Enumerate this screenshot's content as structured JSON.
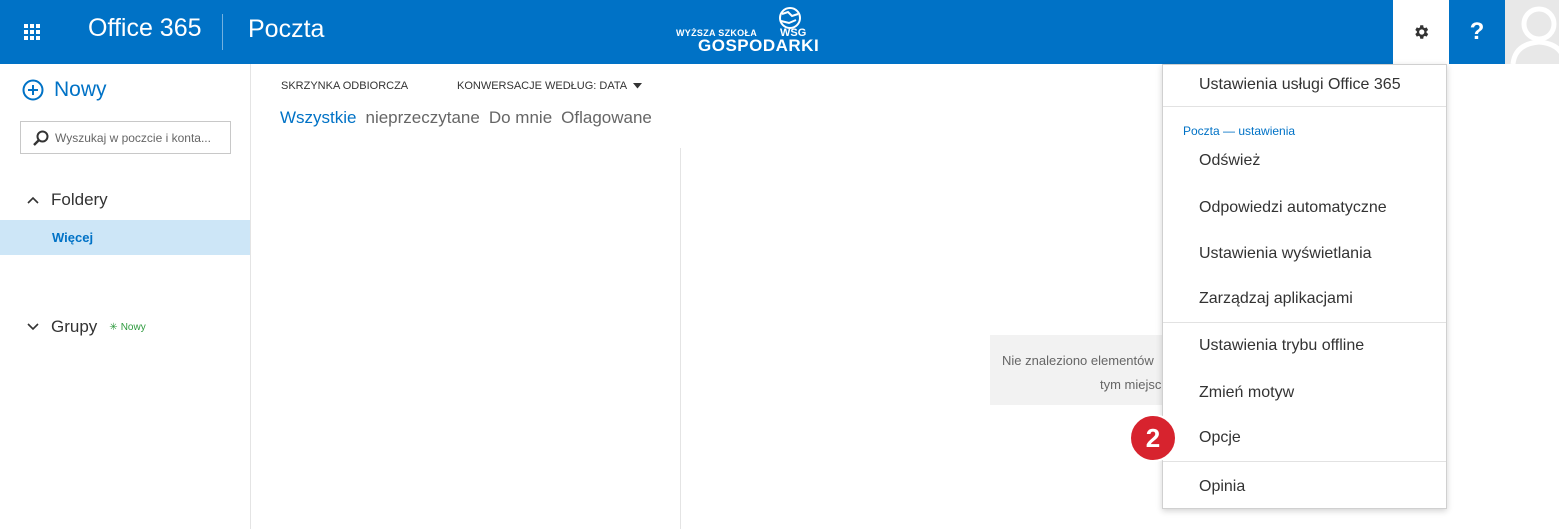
{
  "header": {
    "brand": "Office 365",
    "app_name": "Poczta",
    "logo_line1": "WYŻSZA SZKOŁA",
    "logo_line2": "GOSPODARKI",
    "logo_mark": "WSG",
    "help_label": "?",
    "icons": {
      "waffle": "waffle-icon",
      "settings": "gear-icon",
      "avatar": "user-avatar-icon"
    }
  },
  "sidebar": {
    "new_label": "Nowy",
    "search_placeholder": "Wyszukaj w poczcie i konta...",
    "folders_label": "Foldery",
    "more_label": "Więcej",
    "groups_label": "Grupy",
    "groups_new_badge": "Nowy"
  },
  "message_list": {
    "inbox_label": "SKRZYNKA ODBIORCZA",
    "sort_label": "KONWERSACJE WEDŁUG: DATA",
    "filters": [
      "Wszystkie",
      "nieprzeczytane",
      "Do mnie",
      "Oflagowane"
    ],
    "active_filter": "Wszystkie"
  },
  "reading_pane": {
    "empty_line1": "Nie znaleziono elementów",
    "empty_line2": "tym miejsc"
  },
  "settings_panel": {
    "office_settings": "Ustawienia usługi Office 365",
    "mail_settings_header": "Poczta — ustawienia",
    "items": [
      "Odśwież",
      "Odpowiedzi automatyczne",
      "Ustawienia wyświetlania",
      "Zarządzaj aplikacjami",
      "Ustawienia trybu offline",
      "Zmień motyw",
      "Opcje",
      "Opinia"
    ]
  },
  "annotation": {
    "step_number": "2"
  },
  "colors": {
    "accent": "#0072c6",
    "selected_bg": "#cde6f7",
    "badge": "#d7232e",
    "new_green": "#2e9a3e"
  }
}
